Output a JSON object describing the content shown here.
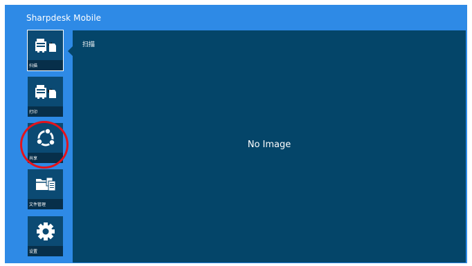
{
  "app": {
    "title": "Sharpdesk Mobile"
  },
  "sidebar": {
    "items": [
      {
        "label": "扫描",
        "icon": "scan-icon"
      },
      {
        "label": "打印",
        "icon": "print-icon"
      },
      {
        "label": "共享",
        "icon": "share-icon"
      },
      {
        "label": "文件管理",
        "icon": "file-management-icon"
      },
      {
        "label": "设置",
        "icon": "settings-gear-icon"
      }
    ]
  },
  "main": {
    "title": "扫描",
    "placeholder": "No Image"
  },
  "colors": {
    "app_background": "#2e8ae6",
    "panel": "#044569",
    "button": "#0b4a73",
    "highlight": "#e3131b"
  }
}
